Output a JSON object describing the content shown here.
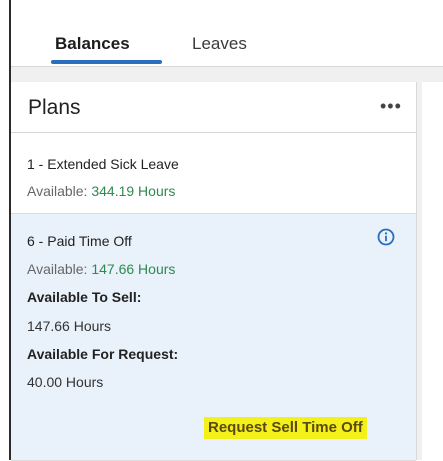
{
  "tabs": [
    {
      "label": "Balances",
      "active": true
    },
    {
      "label": "Leaves",
      "active": false
    }
  ],
  "panel": {
    "title": "Plans",
    "menu_icon": "more-horizontal-icon"
  },
  "plans": [
    {
      "name": "1 - Extended Sick Leave",
      "available_label": "Available:",
      "available_value": "344.19 Hours"
    },
    {
      "name": "6 - Paid Time Off",
      "available_label": "Available:",
      "available_value": "147.66 Hours",
      "sell_label": "Available To Sell:",
      "sell_value": "147.66 Hours",
      "request_label": "Available For Request:",
      "request_value": "40.00 Hours",
      "info_icon": "info-circle-icon",
      "action_label": "Request Sell Time Off"
    }
  ],
  "colors": {
    "accent": "#2a6ebd",
    "available_green": "#2d8a4e",
    "selected_row_bg": "#e9f1fa",
    "highlight": "#f4f01a"
  }
}
